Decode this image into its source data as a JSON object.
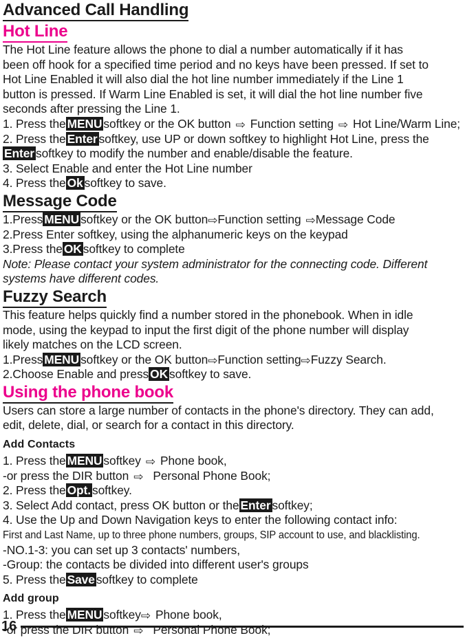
{
  "document": {
    "page_number": "16",
    "accent_color": "#ec008c",
    "text_color": "#1a1a1a",
    "arrow_glyph": "⇨"
  },
  "chapter": {
    "title": "Advanced Call Handling"
  },
  "sections": [
    {
      "heading": "Hot Line",
      "heading_color": "#ec008c",
      "paragraph": [
        "The Hot Line feature allows the phone to dial a number automatically if it has",
        "been off hook for a specified time period and no keys have been pressed. If set to",
        "Hot Line Enabled it will also dial the hot line number immediately if the Line 1",
        "button is pressed.  If Warm Line Enabled is set, it will dial the hot line number five",
        "seconds after pressing the Line 1."
      ],
      "steps": {
        "s1_a": "1. Press the",
        "s1_key": "MENU",
        "s1_b": "softkey or the OK button",
        "s1_c": "Function setting",
        "s1_d": "Hot Line/Warm Line;",
        "s2_a": "2. Press the",
        "s2_key": "Enter",
        "s2_b": "softkey, use UP or down softkey to highlight Hot Line, press the",
        "s2_cont_key": "Enter",
        "s2_cont": "softkey to modify the number and enable/disable the feature.",
        "s3": "3. Select Enable and enter the Hot Line number",
        "s4_a": "4. Press the",
        "s4_key": "Ok",
        "s4_b": "softkey to save."
      }
    },
    {
      "heading": "Message Code",
      "heading_color": "#1a1a1a",
      "steps": {
        "s1_a": "1.Press",
        "s1_key": "MENU",
        "s1_b": "softkey or the OK button",
        "s1_c": "Function setting",
        "s1_d": "Message Code",
        "s2": "2.Press Enter softkey, using the alphanumeric keys on the keypad",
        "s3_a": "3.Press the",
        "s3_key": "OK",
        "s3_b": "softkey to complete"
      },
      "note": [
        "Note:  Please contact your system administrator for the connecting code.  Different",
        "systems have different codes."
      ]
    },
    {
      "heading": "Fuzzy Search",
      "heading_color": "#1a1a1a",
      "paragraph": [
        "This feature helps quickly find a number stored in the phonebook.  When in idle",
        "mode, using the keypad to input the first digit of the phone number will display",
        "likely matches on the LCD screen."
      ],
      "steps": {
        "s1_a": "1.Press",
        "s1_key": "MENU",
        "s1_b": "softkey or the OK button",
        "s1_c": "Function setting",
        "s1_d": "Fuzzy Search.",
        "s2_a": "2.Choose Enable and press",
        "s2_key": "OK",
        "s2_b": "softkey to save."
      }
    },
    {
      "heading": "Using the phone book",
      "heading_color": "#ec008c",
      "paragraph": [
        "Users can store a large number of contacts in the phone's directory. They can add,",
        "edit, delete, dial, or search for a contact in this directory."
      ],
      "subsections": [
        {
          "title": "Add Contacts",
          "steps": {
            "s1_a": "1. Press the",
            "s1_key": "MENU",
            "s1_b": "softkey",
            "s1_c": "Phone book,",
            "s1_alt_a": "-or press the DIR button",
            "s1_alt_b": "Personal Phone Book;",
            "s2_a": "2. Press the",
            "s2_key": "Opt.",
            "s2_b": "softkey.",
            "s3_a": "3. Select Add contact, press OK button or the",
            "s3_key": "Enter",
            "s3_b": "softkey;",
            "s4": "4. Use the Up and Down Navigation keys to enter the following contact info:",
            "s4_detail": "First and Last Name, up to three phone numbers, groups, SIP account to use, and blacklisting.",
            "s4_no": "-NO.1-3: you can set up 3 contacts' numbers,",
            "s4_group": "-Group: the contacts be divided into different user's groups",
            "s5_a": "5. Press the",
            "s5_key": "Save",
            "s5_b": "softkey to complete"
          }
        },
        {
          "title": "Add group",
          "steps": {
            "s1_a": "1. Press the",
            "s1_key": "MENU",
            "s1_b": "softkey",
            "s1_c": "Phone book,",
            "s1_alt_a": "-or press the DIR button",
            "s1_alt_b": "Personal Phone Book;"
          }
        }
      ]
    }
  ]
}
